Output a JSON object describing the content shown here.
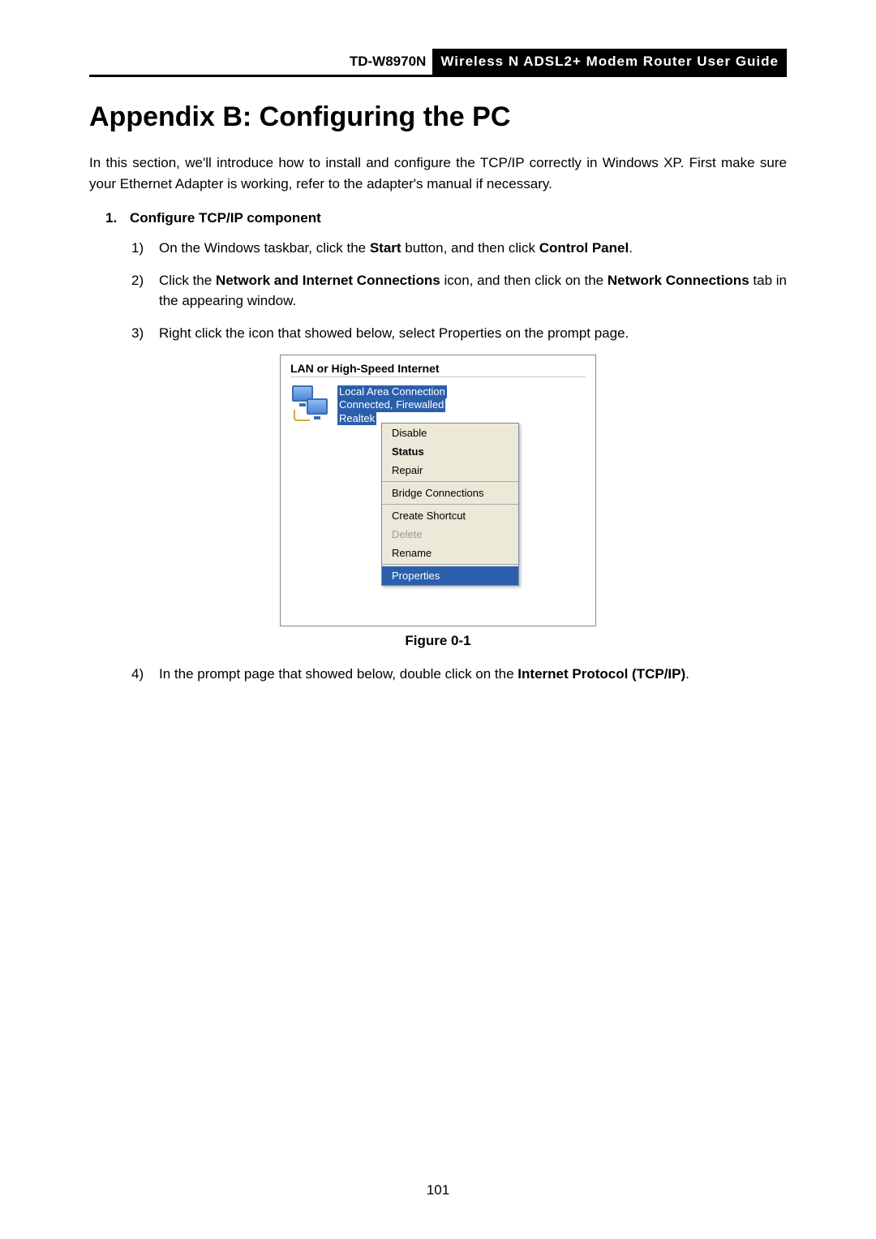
{
  "header": {
    "model": "TD-W8970N",
    "title": "Wireless N ADSL2+ Modem Router User Guide"
  },
  "page_title": "Appendix B: Configuring the PC",
  "intro": "In this section, we'll introduce how to install and configure the TCP/IP correctly in Windows XP. First make sure your Ethernet Adapter is working, refer to the adapter's manual if necessary.",
  "section": {
    "number": "1.",
    "title": "Configure TCP/IP component"
  },
  "steps": [
    {
      "n": "1)",
      "pre": "On the Windows taskbar, click the ",
      "b1": "Start",
      "mid": " button, and then click ",
      "b2": "Control Panel",
      "post": "."
    },
    {
      "n": "2)",
      "pre": "Click the ",
      "b1": "Network and Internet Connections",
      "mid": " icon, and then click on the ",
      "b2": "Network Connections",
      "post": " tab in the appearing window."
    },
    {
      "n": "3)",
      "text": "Right click the icon that showed below, select Properties on the prompt page."
    },
    {
      "n": "4)",
      "pre": "In the prompt page that showed below, double click on the ",
      "b1": "Internet Protocol (TCP/IP)",
      "post": "."
    }
  ],
  "figure": {
    "caption": "Figure 0-1",
    "category_header": "LAN or High-Speed Internet",
    "connection": {
      "name": "Local Area Connection",
      "status": "Connected, Firewalled",
      "device": "Realtek"
    },
    "context_menu": [
      {
        "label": "Disable",
        "type": "item"
      },
      {
        "label": "Status",
        "type": "bold"
      },
      {
        "label": "Repair",
        "type": "item"
      },
      {
        "type": "sep"
      },
      {
        "label": "Bridge Connections",
        "type": "item"
      },
      {
        "type": "sep"
      },
      {
        "label": "Create Shortcut",
        "type": "item"
      },
      {
        "label": "Delete",
        "type": "disabled"
      },
      {
        "label": "Rename",
        "type": "item"
      },
      {
        "type": "sep"
      },
      {
        "label": "Properties",
        "type": "selected"
      }
    ]
  },
  "page_number": "101"
}
